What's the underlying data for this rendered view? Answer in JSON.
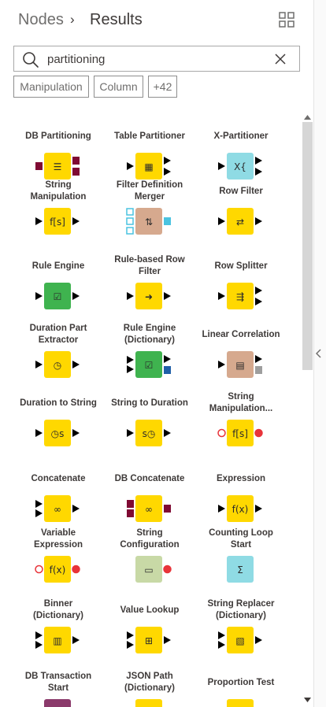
{
  "header": {
    "breadcrumb_root": "Nodes",
    "breadcrumb_current": "Results"
  },
  "search": {
    "value": "partitioning"
  },
  "tags": [
    "Manipulation",
    "Column",
    "+42"
  ],
  "nodes": [
    {
      "label": [
        "DB Partitioning"
      ],
      "icon": "db-partitioning-icon",
      "color": "#ffd800",
      "ports_in": [
        "db"
      ],
      "ports_out": [
        "db",
        "db"
      ]
    },
    {
      "label": [
        "Table Partitioner"
      ],
      "icon": "table-partitioner-icon",
      "color": "#ffd800",
      "ports_in": [
        "data"
      ],
      "ports_out": [
        "data",
        "data"
      ]
    },
    {
      "label": [
        "X-Partitioner"
      ],
      "icon": "x-partitioner-icon",
      "color": "#8fdbe4",
      "ports_in": [
        "data"
      ],
      "ports_out": [
        "data",
        "data"
      ]
    },
    {
      "label": [
        "String",
        "Manipulation"
      ],
      "icon": "string-manipulation-icon",
      "color": "#ffd800",
      "ports_in": [
        "data"
      ],
      "ports_out": [
        "data"
      ]
    },
    {
      "label": [
        "Filter Definition",
        "Merger"
      ],
      "icon": "filter-definition-merger-icon",
      "color": "#d6a98e",
      "ports_in": [
        "table",
        "table",
        "table"
      ],
      "ports_out": [
        "filter"
      ]
    },
    {
      "label": [
        "Row Filter"
      ],
      "icon": "row-filter-icon",
      "color": "#ffd800",
      "ports_in": [
        "data"
      ],
      "ports_out": [
        "data"
      ]
    },
    {
      "label": [
        "Rule Engine"
      ],
      "icon": "rule-engine-icon",
      "color": "#3fb34f",
      "ports_in": [
        "data"
      ],
      "ports_out": [
        "data"
      ]
    },
    {
      "label": [
        "Rule-based Row",
        "Filter"
      ],
      "icon": "rule-based-row-filter-icon",
      "color": "#ffd800",
      "ports_in": [
        "data"
      ],
      "ports_out": [
        "data"
      ]
    },
    {
      "label": [
        "Row Splitter"
      ],
      "icon": "row-splitter-icon",
      "color": "#ffd800",
      "ports_in": [
        "data"
      ],
      "ports_out": [
        "data",
        "data"
      ]
    },
    {
      "label": [
        "Duration Part",
        "Extractor"
      ],
      "icon": "duration-part-extractor-icon",
      "color": "#ffd800",
      "ports_in": [
        "data"
      ],
      "ports_out": [
        "data"
      ]
    },
    {
      "label": [
        "Rule Engine",
        "(Dictionary)"
      ],
      "icon": "rule-engine-dictionary-icon",
      "color": "#3fb34f",
      "ports_in": [
        "data",
        "data"
      ],
      "ports_out": [
        "data",
        "pmml"
      ]
    },
    {
      "label": [
        "Linear Correlation"
      ],
      "icon": "linear-correlation-icon",
      "color": "#d6a98e",
      "ports_in": [
        "data"
      ],
      "ports_out": [
        "data",
        "model"
      ]
    },
    {
      "label": [
        "Duration to String"
      ],
      "icon": "duration-to-string-icon",
      "color": "#ffd800",
      "ports_in": [
        "data"
      ],
      "ports_out": [
        "data"
      ]
    },
    {
      "label": [
        "String to Duration"
      ],
      "icon": "string-to-duration-icon",
      "color": "#ffd800",
      "ports_in": [
        "data"
      ],
      "ports_out": [
        "data"
      ]
    },
    {
      "label": [
        "String",
        "Manipulation..."
      ],
      "icon": "string-manipulation-variable-icon",
      "color": "#ffd800",
      "ports_in": [
        "flow-optional"
      ],
      "ports_out": [
        "flow"
      ]
    },
    {
      "label": [
        "Concatenate"
      ],
      "icon": "concatenate-icon",
      "color": "#ffd800",
      "ports_in": [
        "data",
        "data"
      ],
      "ports_out": [
        "data"
      ]
    },
    {
      "label": [
        "DB Concatenate"
      ],
      "icon": "db-concatenate-icon",
      "color": "#ffd800",
      "ports_in": [
        "db",
        "db"
      ],
      "ports_out": [
        "db"
      ]
    },
    {
      "label": [
        "Expression"
      ],
      "icon": "expression-icon",
      "color": "#ffd800",
      "ports_in": [
        "data"
      ],
      "ports_out": [
        "data"
      ]
    },
    {
      "label": [
        "Variable",
        "Expression"
      ],
      "icon": "variable-expression-icon",
      "color": "#ffd800",
      "ports_in": [
        "flow-optional"
      ],
      "ports_out": [
        "flow"
      ]
    },
    {
      "label": [
        "String",
        "Configuration"
      ],
      "icon": "string-configuration-icon",
      "color": "#c8d9a6",
      "ports_in": [],
      "ports_out": [
        "flow"
      ]
    },
    {
      "label": [
        "Counting Loop",
        "Start"
      ],
      "icon": "counting-loop-start-icon",
      "color": "#8fdbe4",
      "ports_in": [],
      "ports_out": []
    },
    {
      "label": [
        "Binner",
        "(Dictionary)"
      ],
      "icon": "binner-dictionary-icon",
      "color": "#ffd800",
      "ports_in": [
        "data",
        "data"
      ],
      "ports_out": [
        "data"
      ]
    },
    {
      "label": [
        "Value Lookup"
      ],
      "icon": "value-lookup-icon",
      "color": "#ffd800",
      "ports_in": [
        "data",
        "data"
      ],
      "ports_out": [
        "data"
      ]
    },
    {
      "label": [
        "String Replacer",
        "(Dictionary)"
      ],
      "icon": "string-replacer-dictionary-icon",
      "color": "#ffd800",
      "ports_in": [
        "data",
        "data"
      ],
      "ports_out": [
        "data"
      ]
    },
    {
      "label": [
        "DB Transaction",
        "Start"
      ],
      "icon": "db-transaction-start-icon",
      "color": "#8b3a6b",
      "ports_in": [],
      "ports_out": []
    },
    {
      "label": [
        "JSON Path",
        "(Dictionary)"
      ],
      "icon": "json-path-dictionary-icon",
      "color": "#ffd800",
      "ports_in": [],
      "ports_out": []
    },
    {
      "label": [
        "Proportion Test"
      ],
      "icon": "proportion-test-icon",
      "color": "#ffd800",
      "ports_in": [],
      "ports_out": []
    }
  ],
  "colors": {
    "data_port": "#000000",
    "db_port": "#7f0a33",
    "flow_port": "#e8343a",
    "model_port": "#1f5fa8",
    "filter_port": "#4ac3e0"
  }
}
